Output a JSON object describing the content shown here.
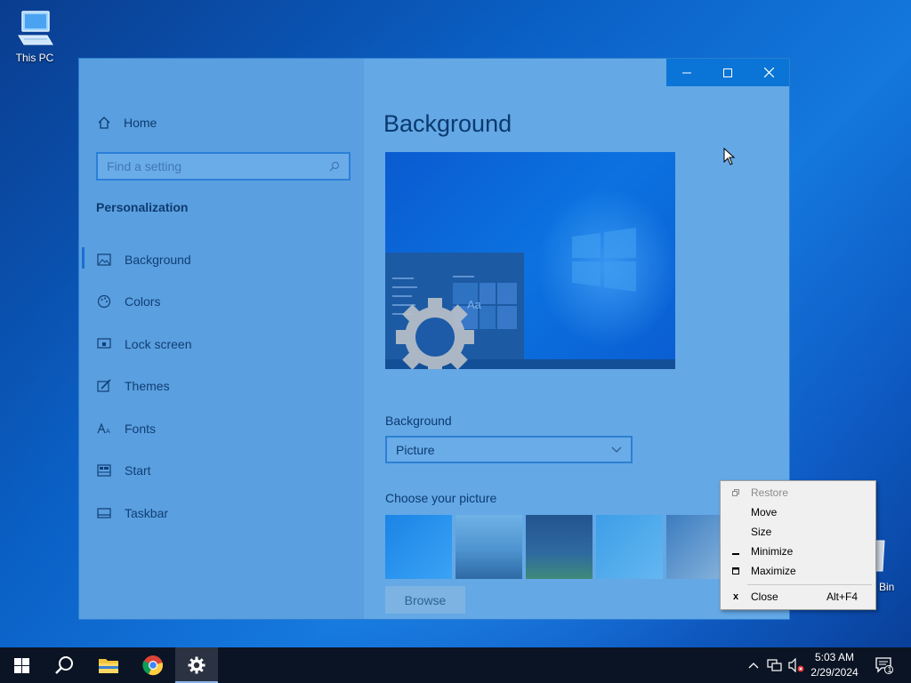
{
  "desktop": {
    "this_pc_label": "This PC",
    "recycle_bin_partial_label": "Bin"
  },
  "window": {
    "title_buttons": {
      "minimize": "—",
      "maximize": "☐",
      "close": "✕"
    },
    "sidebar": {
      "home_label": "Home",
      "search_placeholder": "Find a setting",
      "section_title": "Personalization",
      "items": [
        {
          "label": "Background",
          "icon": "picture-icon",
          "selected": true
        },
        {
          "label": "Colors",
          "icon": "palette-icon",
          "selected": false
        },
        {
          "label": "Lock screen",
          "icon": "lock-screen-icon",
          "selected": false
        },
        {
          "label": "Themes",
          "icon": "brush-icon",
          "selected": false
        },
        {
          "label": "Fonts",
          "icon": "font-icon",
          "selected": false
        },
        {
          "label": "Start",
          "icon": "start-icon",
          "selected": false
        },
        {
          "label": "Taskbar",
          "icon": "taskbar-icon",
          "selected": false
        }
      ]
    },
    "main": {
      "title": "Background",
      "preview_sample_text": "Aa",
      "background_label": "Background",
      "background_value": "Picture",
      "choose_label": "Choose your picture",
      "browse_label": "Browse"
    }
  },
  "context_menu": {
    "items": [
      {
        "label": "Restore",
        "mark": "🗗",
        "disabled": true,
        "accel": ""
      },
      {
        "label": "Move",
        "mark": "",
        "disabled": false,
        "accel": ""
      },
      {
        "label": "Size",
        "mark": "",
        "disabled": false,
        "accel": ""
      },
      {
        "label": "Minimize",
        "mark": "_",
        "disabled": false,
        "accel": ""
      },
      {
        "label": "Maximize",
        "mark": "□",
        "disabled": false,
        "accel": ""
      },
      {
        "label": "Close",
        "mark": "x",
        "disabled": false,
        "accel": "Alt+F4"
      }
    ]
  },
  "taskbar": {
    "time": "5:03 AM",
    "date": "2/29/2024",
    "notification_count": "1"
  },
  "colors": {
    "accent": "#0a75d6",
    "taskbar": "#0b1424"
  }
}
